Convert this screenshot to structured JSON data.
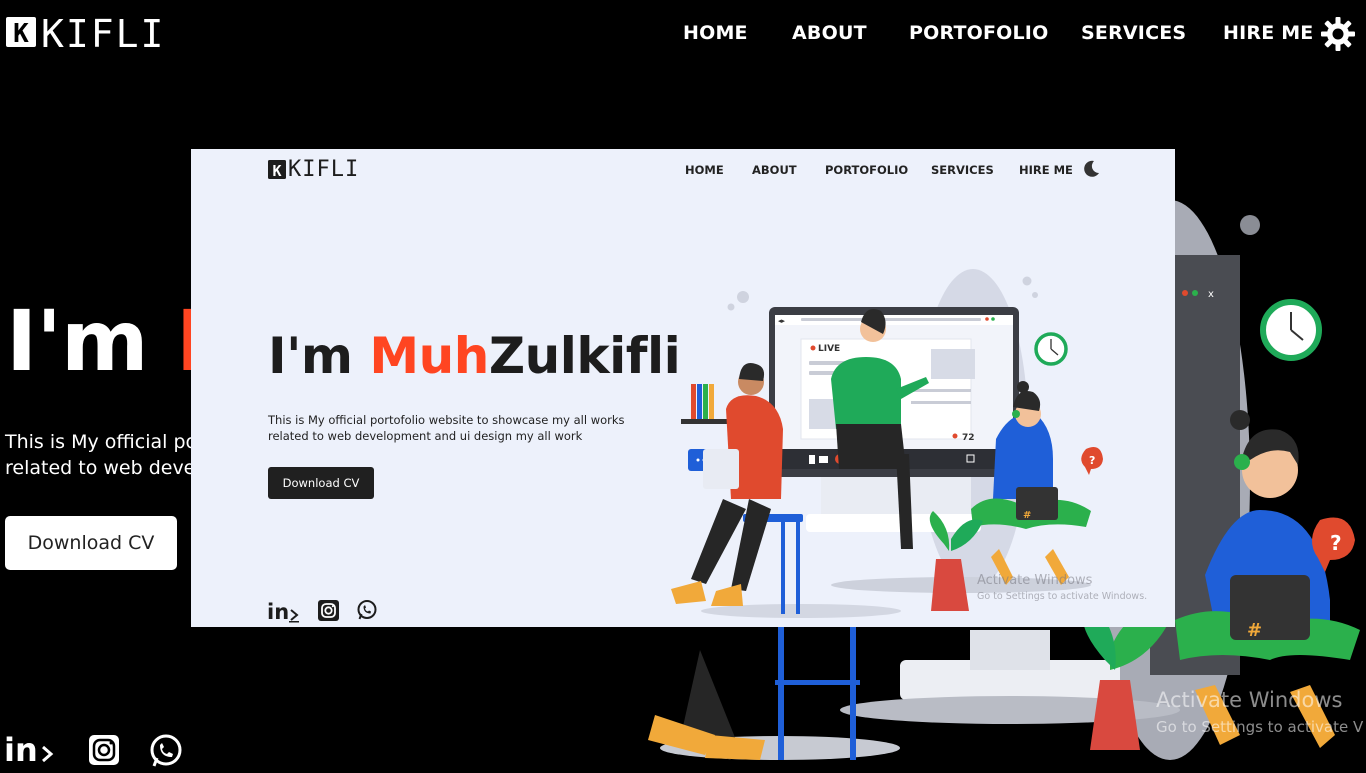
{
  "background_page": {
    "logo": "KIFLI",
    "nav": [
      "HOME",
      "ABOUT",
      "PORTOFOLIO",
      "SERVICES",
      "HIRE ME"
    ],
    "hero_prefix": "I'm ",
    "hero_accent": "M",
    "description_lines": [
      "This is My official po",
      "related to web deve"
    ],
    "download_button": "Download CV",
    "watermark_title": "Activate Windows",
    "watermark_sub": "Go to Settings to activate V"
  },
  "inset_page": {
    "logo": "KIFLI",
    "nav": [
      "HOME",
      "ABOUT",
      "PORTOFOLIO",
      "SERVICES",
      "HIRE ME"
    ],
    "hero_prefix": "I'm ",
    "hero_accent": "Muh",
    "hero_rest": "Zulkifli",
    "description_lines": [
      "This is My official portofolio website to showcase my all works",
      "related to web development and ui design my all work"
    ],
    "download_button": "Download CV",
    "live_badge": "LIVE",
    "viewer_count": "72",
    "watermark_title": "Activate Windows",
    "watermark_sub": "Go to Settings to activate Windows."
  },
  "colors": {
    "accent": "#ff4521",
    "dark_bg": "#000000",
    "light_bg": "#edf1fb",
    "green": "#1faa59",
    "blue": "#1f5fd8"
  },
  "icons": [
    "gear-icon",
    "moon-icon",
    "linkedin-icon",
    "instagram-icon",
    "whatsapp-icon"
  ]
}
